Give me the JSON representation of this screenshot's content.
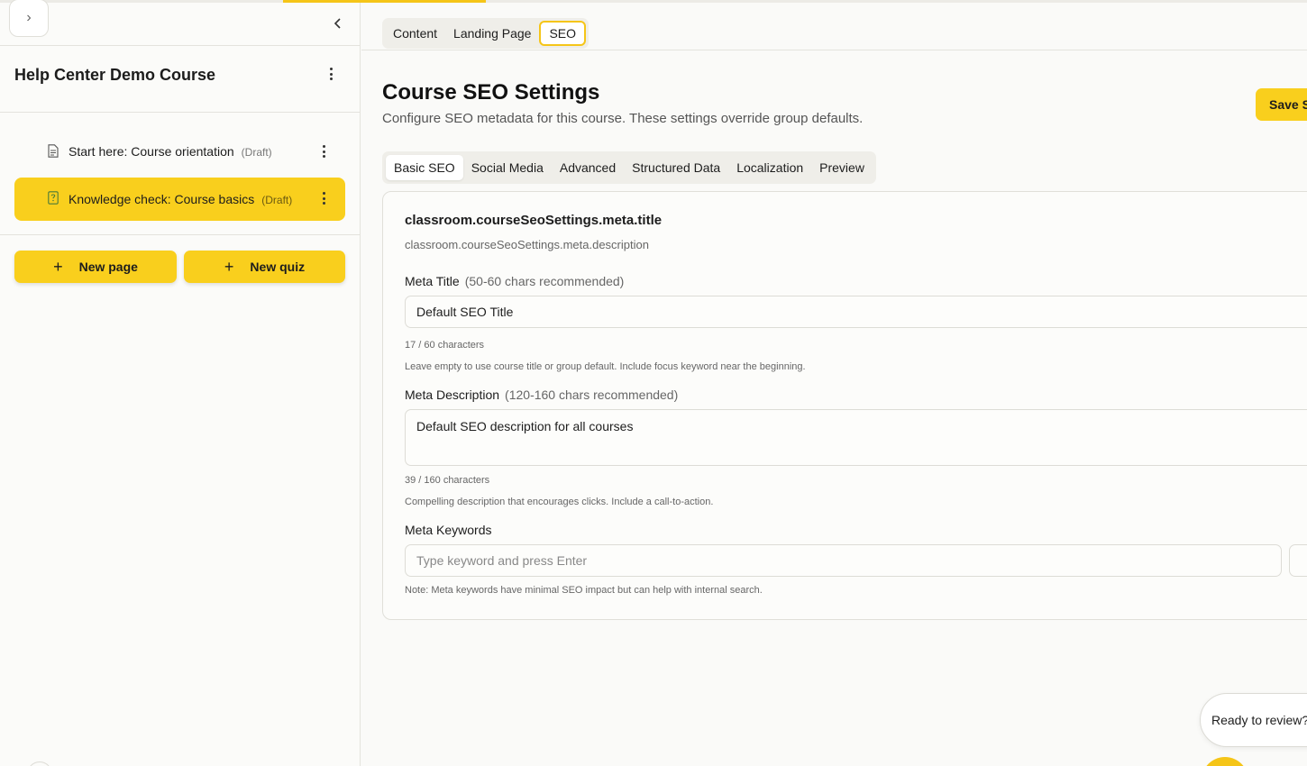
{
  "sidebar": {
    "course_title": "Help Center Demo Course",
    "pages": [
      {
        "label": "Start here: Course orientation",
        "status": "(Draft)",
        "icon": "document-icon",
        "selected": false
      },
      {
        "label": "Knowledge check: Course basics",
        "status": "(Draft)",
        "icon": "quiz-icon",
        "selected": true
      }
    ],
    "new_page_label": "New page",
    "new_quiz_label": "New quiz"
  },
  "top_tabs": [
    {
      "label": "Content",
      "active": false
    },
    {
      "label": "Landing Page",
      "active": false
    },
    {
      "label": "SEO",
      "active": true
    }
  ],
  "header": {
    "title": "Course SEO Settings",
    "subtitle": "Configure SEO metadata for this course. These settings override group defaults.",
    "save_label": "Save S"
  },
  "sub_tabs": [
    {
      "label": "Basic SEO",
      "active": true
    },
    {
      "label": "Social Media",
      "active": false
    },
    {
      "label": "Advanced",
      "active": false
    },
    {
      "label": "Structured Data",
      "active": false
    },
    {
      "label": "Localization",
      "active": false
    },
    {
      "label": "Preview",
      "active": false
    }
  ],
  "card": {
    "title": "classroom.courseSeoSettings.meta.title",
    "description": "classroom.courseSeoSettings.meta.description",
    "meta_title": {
      "label": "Meta Title",
      "hint": "(50-60 chars recommended)",
      "value": "Default SEO Title",
      "count": "17 / 60 characters",
      "help": "Leave empty to use course title or group default. Include focus keyword near the beginning."
    },
    "meta_description": {
      "label": "Meta Description",
      "hint": "(120-160 chars recommended)",
      "value": "Default SEO description for all courses",
      "count": "39 / 160 characters",
      "help": "Compelling description that encourages clicks. Include a call-to-action."
    },
    "meta_keywords": {
      "label": "Meta Keywords",
      "placeholder": "Type keyword and press Enter",
      "note": "Note: Meta keywords have minimal SEO impact but can help with internal search."
    }
  },
  "review_prompt": "Ready to review?",
  "colors": {
    "accent": "#f9cf1d",
    "background": "#fafaf8",
    "border": "#e4e3dd"
  }
}
